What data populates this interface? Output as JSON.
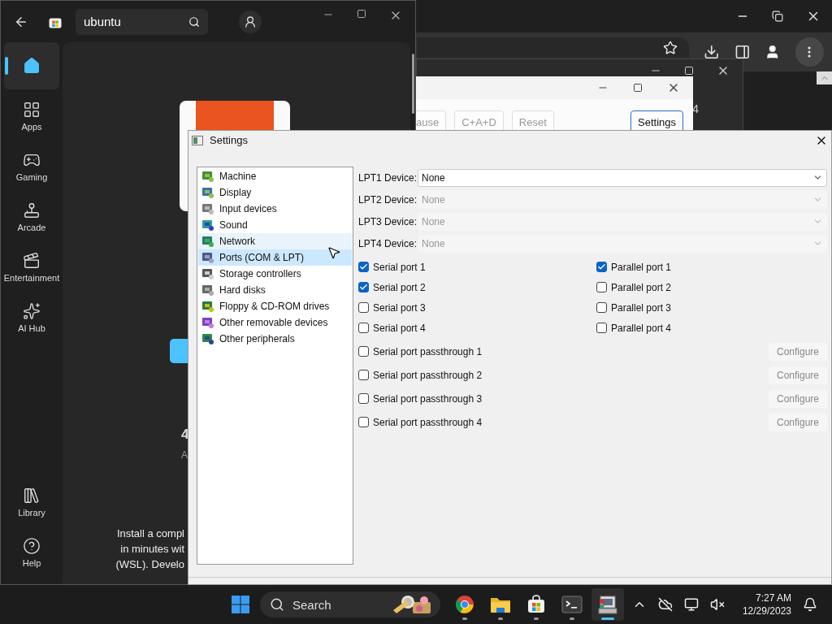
{
  "store_window": {
    "search": {
      "value": "ubuntu"
    },
    "nav": [
      {
        "selected": true
      },
      {
        "label": "Apps",
        "selected": false
      },
      {
        "label": "Gaming",
        "selected": false
      },
      {
        "label": "Arcade",
        "selected": false
      },
      {
        "label": "Entertainment",
        "selected": false
      },
      {
        "label": "AI Hub",
        "selected": false
      },
      {
        "label": "Library",
        "selected": false
      },
      {
        "label": "Help",
        "selected": false
      }
    ],
    "content": {
      "heading": "4",
      "subtitle": "A",
      "description_lines": [
        "Install a compl",
        "in minutes wit",
        "(WSL). Develo"
      ]
    }
  },
  "background_window": {
    "text": "4"
  },
  "emulator_window": {
    "toolbar_buttons": [
      {
        "label": "ause",
        "selected": false
      },
      {
        "label": "C+A+D",
        "selected": false
      },
      {
        "label": "Reset",
        "selected": false
      },
      {
        "label": "Settings",
        "selected": true
      }
    ]
  },
  "settings_dialog": {
    "title": "Settings",
    "categories": [
      {
        "label": "Machine",
        "selected": false,
        "hovered": false
      },
      {
        "label": "Display",
        "selected": false,
        "hovered": false
      },
      {
        "label": "Input devices",
        "selected": false,
        "hovered": false
      },
      {
        "label": "Sound",
        "selected": false,
        "hovered": false
      },
      {
        "label": "Network",
        "selected": false,
        "hovered": true
      },
      {
        "label": "Ports (COM & LPT)",
        "selected": true,
        "hovered": false
      },
      {
        "label": "Storage controllers",
        "selected": false,
        "hovered": false
      },
      {
        "label": "Hard disks",
        "selected": false,
        "hovered": false
      },
      {
        "label": "Floppy & CD-ROM drives",
        "selected": false,
        "hovered": false
      },
      {
        "label": "Other removable devices",
        "selected": false,
        "hovered": false
      },
      {
        "label": "Other peripherals",
        "selected": false,
        "hovered": false
      }
    ],
    "lpt_devices": [
      {
        "label": "LPT1 Device:",
        "value": "None",
        "disabled": false
      },
      {
        "label": "LPT2 Device:",
        "value": "None",
        "disabled": true
      },
      {
        "label": "LPT3 Device:",
        "value": "None",
        "disabled": true
      },
      {
        "label": "LPT4 Device:",
        "value": "None",
        "disabled": true
      }
    ],
    "serial_ports": [
      {
        "label": "Serial port 1",
        "checked": true
      },
      {
        "label": "Serial port 2",
        "checked": true
      },
      {
        "label": "Serial port 3",
        "checked": false
      },
      {
        "label": "Serial port 4",
        "checked": false
      }
    ],
    "parallel_ports": [
      {
        "label": "Parallel port 1",
        "checked": true
      },
      {
        "label": "Parallel port 2",
        "checked": false
      },
      {
        "label": "Parallel port 3",
        "checked": false
      },
      {
        "label": "Parallel port 4",
        "checked": false
      }
    ],
    "passthrough": [
      {
        "label": "Serial port passthrough 1",
        "checked": false,
        "button": {
          "label": "Configure",
          "disabled": true
        }
      },
      {
        "label": "Serial port passthrough 2",
        "checked": false,
        "button": {
          "label": "Configure",
          "disabled": true
        }
      },
      {
        "label": "Serial port passthrough 3",
        "checked": false,
        "button": {
          "label": "Configure",
          "disabled": true
        }
      },
      {
        "label": "Serial port passthrough 4",
        "checked": false,
        "button": {
          "label": "Configure",
          "disabled": true
        }
      }
    ]
  },
  "taskbar": {
    "search": {
      "placeholder": "Search"
    },
    "apps": [
      {
        "active": false
      },
      {
        "active": false
      },
      {
        "active": false
      },
      {
        "active": false
      },
      {
        "active": true
      }
    ],
    "time": "7:27 AM",
    "date": "12/29/2023"
  }
}
